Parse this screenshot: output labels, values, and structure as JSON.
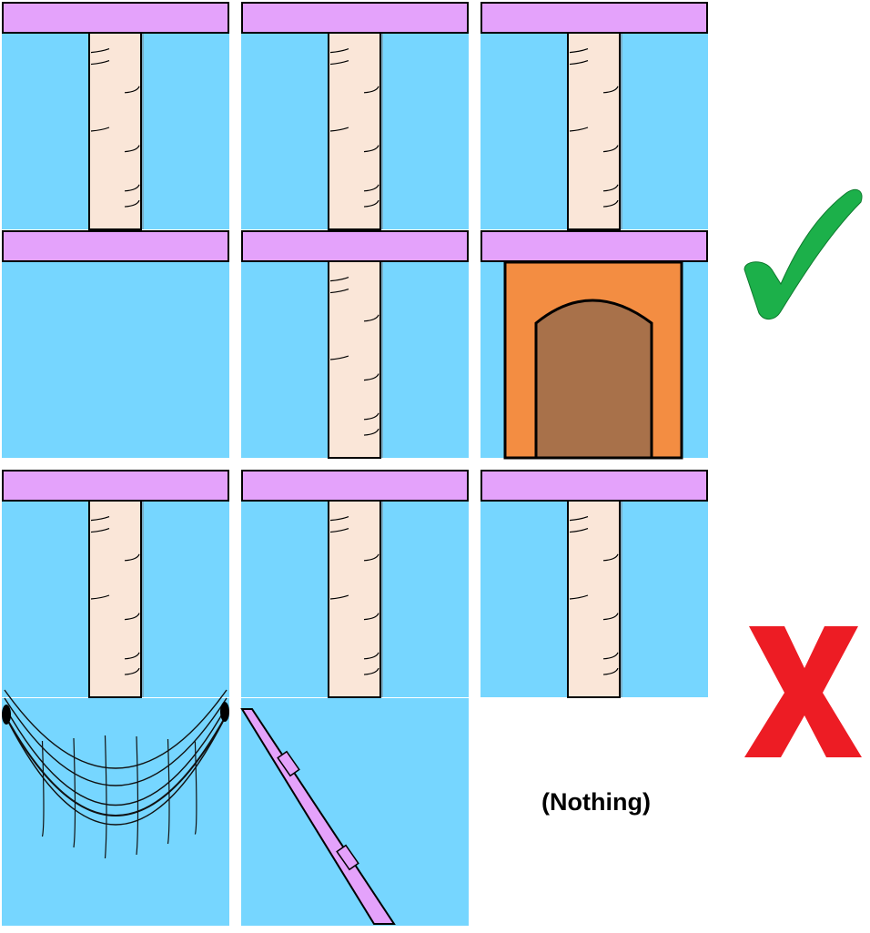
{
  "colors": {
    "sky": "#76d6ff",
    "platform": "#e4a2fb",
    "post": "#fae6d8",
    "house": "#f38d42",
    "door": "#a8714a",
    "check": "#1cb04a",
    "cross": "#ed1c24",
    "net": "#111111"
  },
  "rows": [
    {
      "result": "correct",
      "result_icon": "check-mark-icon",
      "tiles": [
        [
          "platform-post",
          "platform-post",
          "platform-post"
        ],
        [
          "platform-only",
          "platform-post",
          "platform-house"
        ]
      ]
    },
    {
      "result": "incorrect",
      "result_icon": "cross-mark-icon",
      "tiles": [
        [
          "platform-post",
          "platform-post",
          "platform-post"
        ],
        [
          "hammock",
          "ramp",
          "nothing"
        ]
      ]
    }
  ],
  "nothing_label": "(Nothing)"
}
